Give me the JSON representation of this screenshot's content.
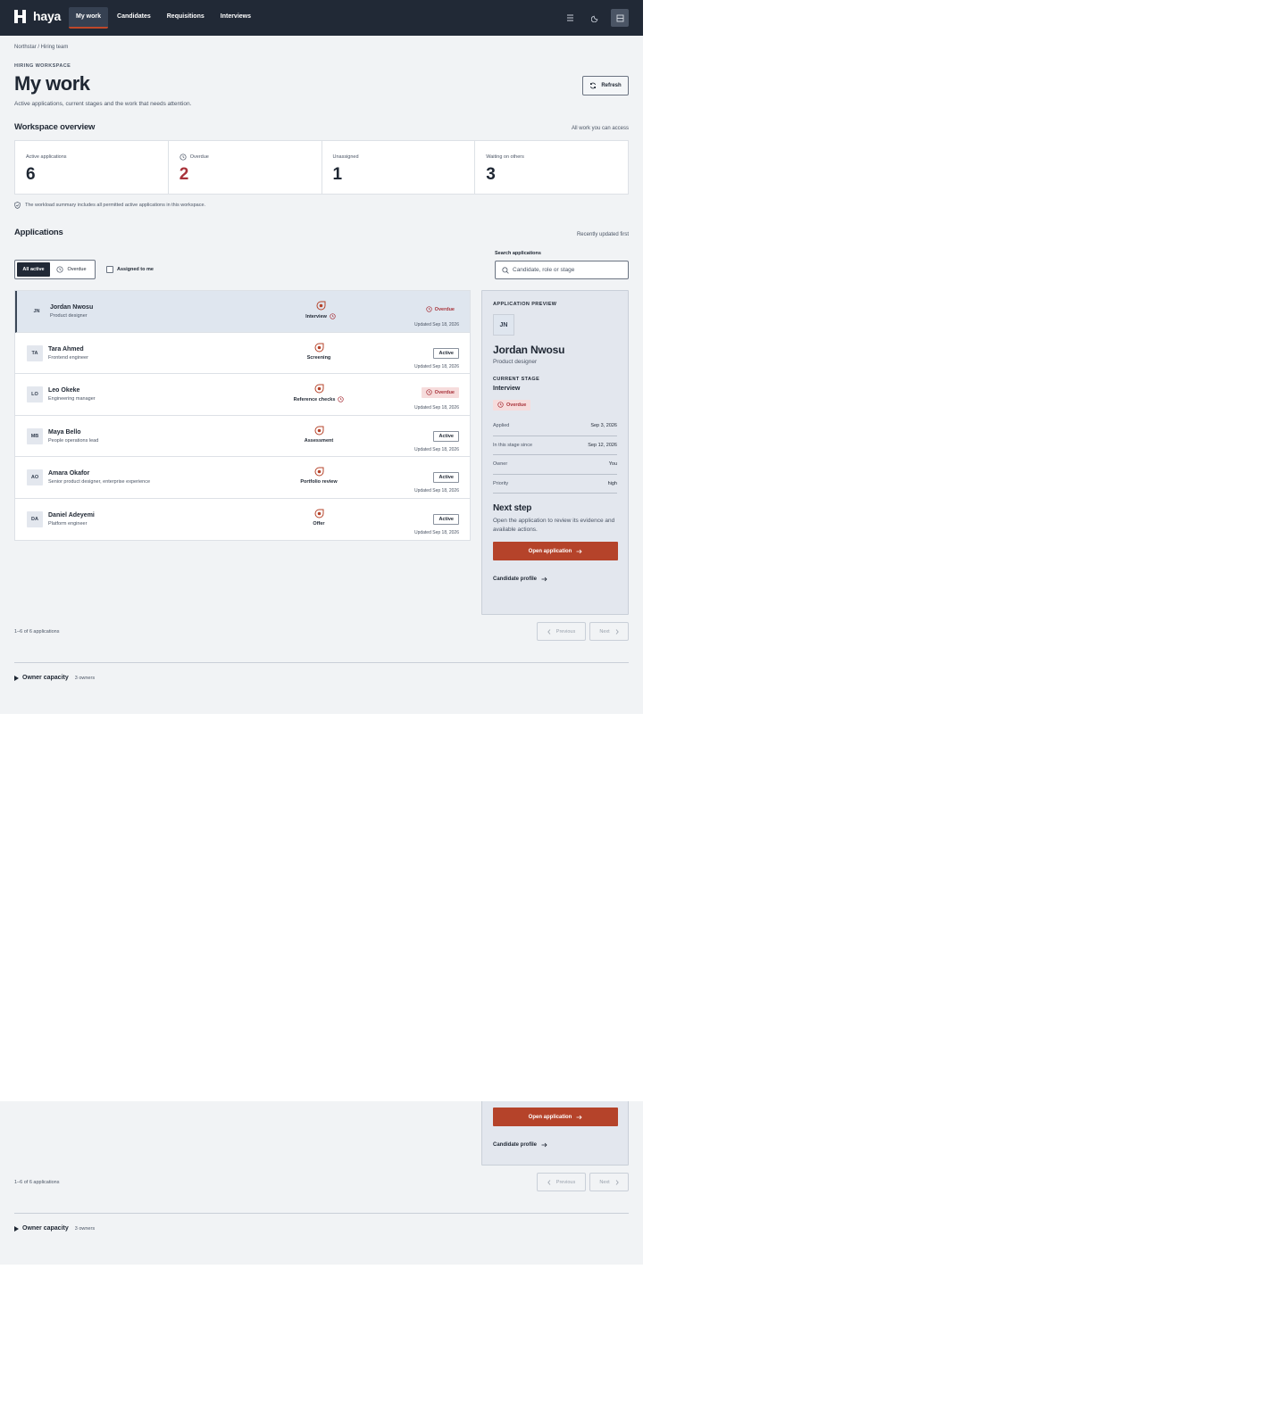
{
  "brand": {
    "name": "haya"
  },
  "nav": {
    "items": [
      "My work",
      "Candidates",
      "Requisitions",
      "Interviews"
    ],
    "active": "My work"
  },
  "header": {
    "breadcrumb": "Northstar / Hiring team",
    "eyebrow": "HIRING WORKSPACE",
    "title": "My work",
    "description": "Active applications, current stages and the work that needs attention.",
    "refresh_label": "Refresh"
  },
  "overview": {
    "title": "Workspace overview",
    "scope": "All work you can access",
    "stats": [
      {
        "label": "Active applications",
        "value": "6"
      },
      {
        "label": "Overdue",
        "value": "2",
        "icon": "clock-icon"
      },
      {
        "label": "Unassigned",
        "value": "1"
      },
      {
        "label": "Waiting on others",
        "value": "3"
      }
    ],
    "note": "The workload summary includes all permitted active applications in this workspace."
  },
  "applications": {
    "title": "Applications",
    "sort": "Recently updated first",
    "filters": {
      "all": "All active",
      "overdue": "Overdue",
      "assigned": "Assigned to me"
    },
    "search": {
      "label": "Search applications",
      "placeholder": "Candidate, role or stage"
    },
    "rows": [
      {
        "initials": "JN",
        "name": "Jordan Nwosu",
        "role": "Product designer",
        "stage": "Interview",
        "stage_overdue": true,
        "status": "Overdue",
        "updated": "Updated Sep 18, 2026"
      },
      {
        "initials": "TA",
        "name": "Tara Ahmed",
        "role": "Frontend engineer",
        "stage": "Screening",
        "stage_overdue": false,
        "status": "Active",
        "updated": "Updated Sep 18, 2026"
      },
      {
        "initials": "LO",
        "name": "Leo Okeke",
        "role": "Engineering manager",
        "stage": "Reference checks",
        "stage_overdue": true,
        "status": "Overdue",
        "updated": "Updated Sep 18, 2026"
      },
      {
        "initials": "MB",
        "name": "Maya Bello",
        "role": "People operations lead",
        "stage": "Assessment",
        "stage_overdue": false,
        "status": "Active",
        "updated": "Updated Sep 18, 2026"
      },
      {
        "initials": "AO",
        "name": "Amara Okafor",
        "role": "Senior product designer, enterprise experience",
        "stage": "Portfolio review",
        "stage_overdue": false,
        "status": "Active",
        "updated": "Updated Sep 18, 2026"
      },
      {
        "initials": "DA",
        "name": "Daniel Adeyemi",
        "role": "Platform engineer",
        "stage": "Offer",
        "stage_overdue": false,
        "status": "Active",
        "updated": "Updated Sep 18, 2026"
      }
    ],
    "count": "1–6 of 6 applications",
    "prev": "Previous",
    "next": "Next"
  },
  "preview": {
    "eyebrow": "APPLICATION PREVIEW",
    "initials": "JN",
    "name": "Jordan Nwosu",
    "role": "Product designer",
    "stage_label": "CURRENT STAGE",
    "stage": "Interview",
    "status": "Overdue",
    "details": [
      {
        "k": "Applied",
        "v": "Sep 3, 2026"
      },
      {
        "k": "In this stage since",
        "v": "Sep 12, 2026"
      },
      {
        "k": "Owner",
        "v": "You"
      },
      {
        "k": "Priority",
        "v": "high"
      }
    ],
    "next_title": "Next step",
    "next_text": "Open the application to review its evidence and available actions.",
    "cta": "Open application",
    "profile_link": "Candidate profile"
  },
  "owner_capacity": {
    "label": "Owner capacity",
    "count": "3 owners"
  },
  "colors": {
    "nav_bg": "#212936",
    "accent": "#b5432a",
    "overdue": "#a8323a",
    "page_bg": "#f1f3f5"
  }
}
